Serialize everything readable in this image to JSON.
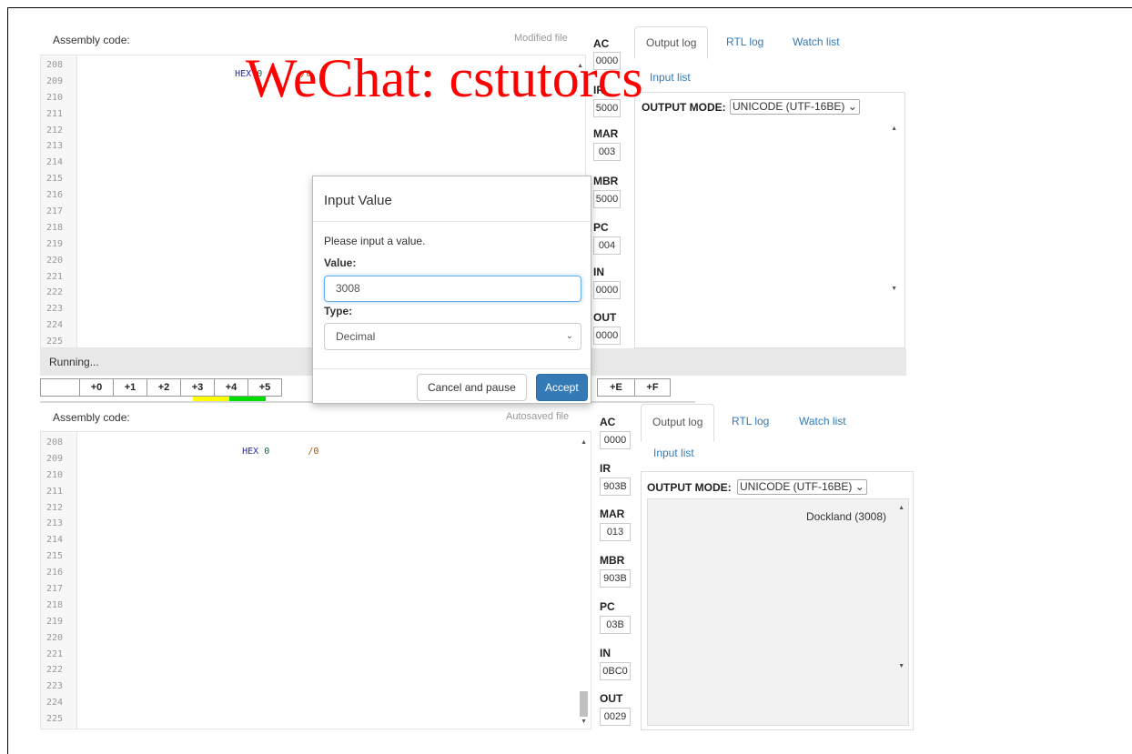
{
  "top_panel": {
    "assembly_label": "Assembly code:",
    "file_status": "Modified file",
    "line_numbers": [
      "208",
      "209",
      "210",
      "211",
      "212",
      "213",
      "214",
      "215",
      "216",
      "217",
      "218",
      "219",
      "220",
      "221",
      "222",
      "223",
      "224",
      "225"
    ],
    "code_line_208": {
      "keyword": "HEX",
      "value": "0",
      "comment": "/0"
    },
    "registers": [
      {
        "name": "AC",
        "value": "0000"
      },
      {
        "name": "IR",
        "value": "5000"
      },
      {
        "name": "MAR",
        "value": "003"
      },
      {
        "name": "MBR",
        "value": "5000"
      },
      {
        "name": "PC",
        "value": "004"
      },
      {
        "name": "IN",
        "value": "0000"
      },
      {
        "name": "OUT",
        "value": "0000"
      }
    ],
    "tabs": [
      "Output log",
      "RTL log",
      "Watch list"
    ],
    "input_list_tab": "Input list",
    "output_mode_label": "OUTPUT MODE:",
    "output_mode_value": "UNICODE (UTF-16BE)",
    "status": "Running...",
    "memory_headers": [
      "+0",
      "+1",
      "+2",
      "+3",
      "+4",
      "+5"
    ],
    "memory_headers_right": [
      "+E",
      "+F"
    ]
  },
  "modal": {
    "title": "Input Value",
    "prompt": "Please input a value.",
    "value_label": "Value:",
    "value": "3008",
    "type_label": "Type:",
    "type_value": "Decimal",
    "cancel_label": "Cancel and pause",
    "accept_label": "Accept"
  },
  "bottom_panel": {
    "assembly_label": "Assembly code:",
    "file_status": "Autosaved file",
    "line_numbers": [
      "208",
      "209",
      "210",
      "211",
      "212",
      "213",
      "214",
      "215",
      "216",
      "217",
      "218",
      "219",
      "220",
      "221",
      "222",
      "223",
      "224",
      "225"
    ],
    "code_line_208": {
      "keyword": "HEX",
      "value": "0",
      "comment": "/0"
    },
    "registers": [
      {
        "name": "AC",
        "value": "0000"
      },
      {
        "name": "IR",
        "value": "903B"
      },
      {
        "name": "MAR",
        "value": "013"
      },
      {
        "name": "MBR",
        "value": "903B"
      },
      {
        "name": "PC",
        "value": "03B"
      },
      {
        "name": "IN",
        "value": "0BC0"
      },
      {
        "name": "OUT",
        "value": "0029"
      }
    ],
    "tabs": [
      "Output log",
      "RTL log",
      "Watch list"
    ],
    "input_list_tab": "Input list",
    "output_mode_label": "OUTPUT MODE:",
    "output_mode_value": "UNICODE (UTF-16BE)",
    "output_text": "Dockland (3008)"
  },
  "watermark": "WeChat: cstutorcs"
}
